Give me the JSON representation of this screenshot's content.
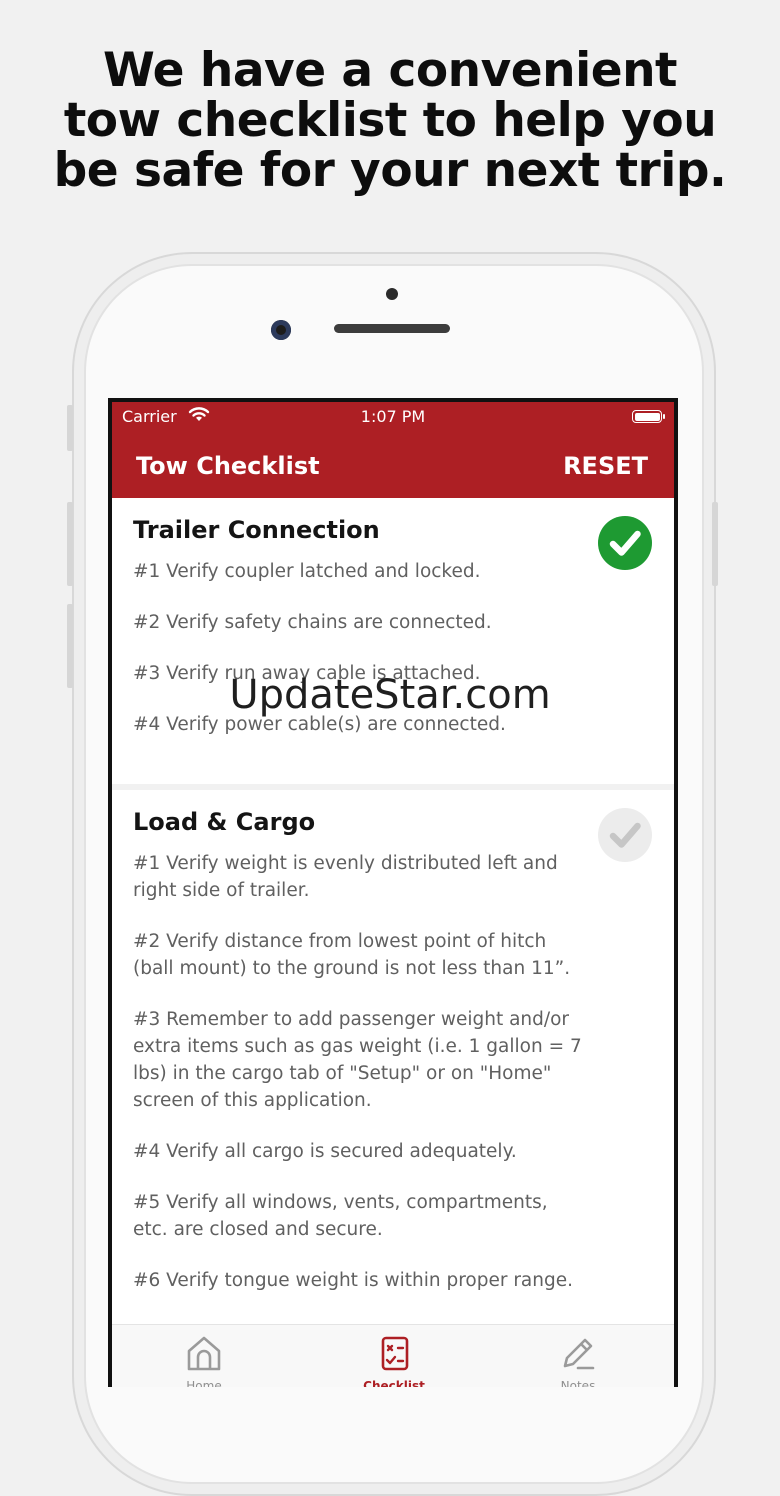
{
  "headline": {
    "line1": "We have a convenient",
    "line2": "tow checklist to help you",
    "line3": "be safe for your next trip."
  },
  "status_bar": {
    "carrier": "Carrier",
    "time": "1:07 PM"
  },
  "app_bar": {
    "title": "Tow Checklist",
    "reset_label": "RESET"
  },
  "sections": [
    {
      "title": "Trailer Connection",
      "completed": true,
      "items": [
        "#1 Verify coupler latched and locked.",
        "#2 Verify safety chains are connected.",
        "#3 Verify run away cable is attached.",
        "#4 Verify power cable(s) are connected."
      ]
    },
    {
      "title": "Load & Cargo",
      "completed": false,
      "items": [
        "#1 Verify weight is evenly distributed left and right side of trailer.",
        "#2 Verify distance from lowest point of hitch (ball mount) to the ground is not less than 11”.",
        "#3 Remember to add passenger weight and/or extra items such as gas weight (i.e. 1 gallon = 7 lbs) in the cargo tab of \"Setup\" or on \"Home\" screen of this application.",
        "#4 Verify all cargo is secured adequately.",
        "#5 Verify all windows, vents, compartments, etc. are closed and secure.",
        "#6 Verify tongue weight is within proper range."
      ]
    }
  ],
  "tabs": [
    {
      "label": "Home",
      "icon": "home-icon"
    },
    {
      "label": "Checklist",
      "icon": "checklist-icon",
      "active": true
    },
    {
      "label": "Notes",
      "icon": "pencil-icon"
    }
  ],
  "watermark": "UpdateStar.com",
  "colors": {
    "brand_red": "#ad1f24",
    "check_green": "#1e9a32"
  }
}
